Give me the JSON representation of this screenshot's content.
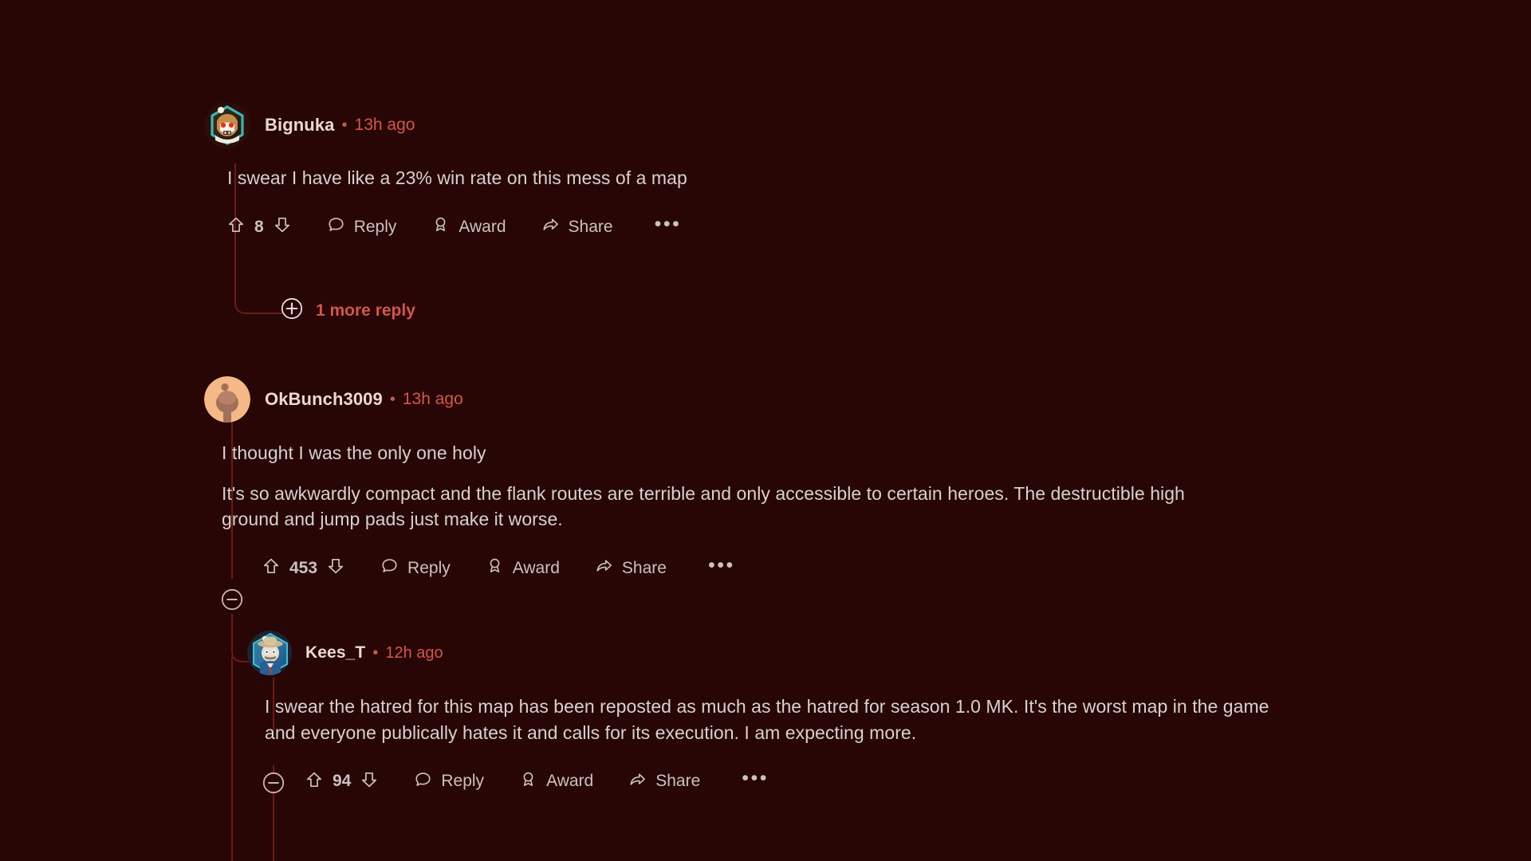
{
  "theme": {
    "background": "#270605",
    "thread_line": "#6e1a17",
    "username": "#e9d9d7",
    "timestamp": "#d4564c",
    "body_text": "#d6d2d0",
    "action_text": "#c9c2c0",
    "more_reply_text": "#d4564c"
  },
  "comments": [
    {
      "id": "bignuka",
      "username": "Bignuka",
      "separator": "•",
      "age": "13h ago",
      "avatar": "hex-wolf-avatar",
      "paragraphs": [
        "I swear I have like a 23% win rate on this mess of a map"
      ],
      "actions": {
        "score": "8",
        "upvote_icon": "upvote-arrow-icon",
        "downvote_icon": "downvote-arrow-icon",
        "reply_icon": "speech-bubble-icon",
        "reply_label": "Reply",
        "award_icon": "award-ribbon-icon",
        "award_label": "Award",
        "share_icon": "share-arrow-icon",
        "share_label": "Share",
        "overflow_icon": "ellipsis-icon",
        "overflow_label": "•••"
      },
      "more_replies": {
        "icon": "plus-circle-icon",
        "label": "1 more reply"
      }
    },
    {
      "id": "okbunch3009",
      "username": "OkBunch3009",
      "separator": "•",
      "age": "13h ago",
      "avatar": "snoo-default-avatar",
      "paragraphs": [
        "I thought I was the only one holy",
        "It's so awkwardly compact and the flank routes are terrible and only accessible to certain heroes. The destructible high ground and jump pads just make it worse."
      ],
      "actions": {
        "collapse_icon": "collapse-minus-icon",
        "score": "453",
        "upvote_icon": "upvote-arrow-icon",
        "downvote_icon": "downvote-arrow-icon",
        "reply_icon": "speech-bubble-icon",
        "reply_label": "Reply",
        "award_icon": "award-ribbon-icon",
        "award_label": "Award",
        "share_icon": "share-arrow-icon",
        "share_label": "Share",
        "overflow_icon": "ellipsis-icon",
        "overflow_label": "•••"
      }
    },
    {
      "id": "kees_t",
      "username": "Kees_T",
      "separator": "•",
      "age": "12h ago",
      "avatar": "cowboy-snoo-avatar",
      "paragraphs": [
        "I swear the hatred for this map has been reposted as much as the hatred for season 1.0 MK. It's the worst map in the game and everyone publically hates it and calls for its execution. I am expecting more."
      ],
      "actions": {
        "collapse_icon": "collapse-minus-icon",
        "score": "94",
        "upvote_icon": "upvote-arrow-icon",
        "downvote_icon": "downvote-arrow-icon",
        "reply_icon": "speech-bubble-icon",
        "reply_label": "Reply",
        "award_icon": "award-ribbon-icon",
        "award_label": "Award",
        "share_icon": "share-arrow-icon",
        "share_label": "Share",
        "overflow_icon": "ellipsis-icon",
        "overflow_label": "•••"
      }
    }
  ]
}
